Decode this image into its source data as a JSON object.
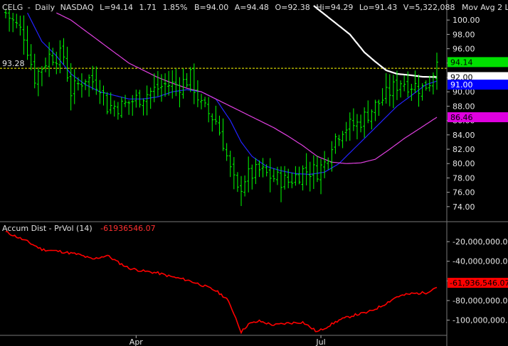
{
  "header": {
    "symbol": "CELG",
    "period": "Daily",
    "exchange": "NASDAQ",
    "last": "L=94.14",
    "change": "1.71",
    "change_pct": "1.85%",
    "bid": "B=94.00",
    "ask": "A=94.48",
    "open": "O=92.38",
    "high": "Hi=94.29",
    "low": "Lo=91.43",
    "volume": "V=5,322,088",
    "study": "Mov Avg 2 Lines ..."
  },
  "reference_line": {
    "label": "93.28",
    "value": 93.28,
    "color": "#ffff00"
  },
  "price_tags": [
    {
      "text": "94.14",
      "value": 94.14,
      "bg": "#00e000",
      "fg": "#000000"
    },
    {
      "text": "92.00",
      "value": 92.05,
      "bg": "#ffffff",
      "fg": "#000000"
    },
    {
      "text": "91.00",
      "value": 91.0,
      "bg": "#0000ff",
      "fg": "#ffffff"
    },
    {
      "text": "86.46",
      "value": 86.46,
      "bg": "#e000e0",
      "fg": "#000000"
    }
  ],
  "lower_panel": {
    "title": "Accum Dist - PrVol (14)",
    "value_label": "-61936546.07",
    "tag_text": "-61,936,546.07",
    "tag_value": -61936546.07,
    "tag_bg": "#ff0000",
    "tag_fg": "#000000"
  },
  "colors": {
    "bars": "#00ff00",
    "ma_short": "#2323ff",
    "ma_mid": "#e040e0",
    "ma_long": "#ffffff",
    "ad_line": "#ff0000",
    "grid": "#444444"
  },
  "chart_data": [
    {
      "type": "ohlc",
      "panel": "price",
      "ylim": [
        72.5,
        102.0
      ],
      "yticks": [
        "100.00",
        "98.00",
        "96.00",
        "94.00",
        "92.00",
        "90.00",
        "88.00",
        "86.00",
        "84.00",
        "82.00",
        "80.00",
        "78.00",
        "76.00",
        "74.00"
      ],
      "ytick_values": [
        100,
        98,
        96,
        94,
        92,
        90,
        88,
        86,
        84,
        82,
        80,
        78,
        76,
        74
      ],
      "xticks": [
        {
          "label": "Apr",
          "index": 36
        },
        {
          "label": "Jul",
          "index": 87
        }
      ],
      "bars": 120,
      "close_anchors": [
        [
          0,
          101
        ],
        [
          5,
          98
        ],
        [
          8,
          92
        ],
        [
          12,
          95
        ],
        [
          16,
          95
        ],
        [
          18,
          90
        ],
        [
          22,
          92
        ],
        [
          26,
          91
        ],
        [
          28,
          88
        ],
        [
          32,
          88
        ],
        [
          36,
          89
        ],
        [
          40,
          90
        ],
        [
          44,
          91
        ],
        [
          48,
          91
        ],
        [
          51,
          92
        ],
        [
          54,
          88
        ],
        [
          58,
          86
        ],
        [
          60,
          83
        ],
        [
          62,
          79
        ],
        [
          64,
          76
        ],
        [
          66,
          78
        ],
        [
          70,
          79
        ],
        [
          74,
          78
        ],
        [
          78,
          77.5
        ],
        [
          82,
          79
        ],
        [
          86,
          79
        ],
        [
          88,
          80
        ],
        [
          90,
          83
        ],
        [
          93,
          85
        ],
        [
          97,
          85.5
        ],
        [
          100,
          87
        ],
        [
          103,
          88.5
        ],
        [
          106,
          90
        ],
        [
          109,
          91.5
        ],
        [
          112,
          91
        ],
        [
          115,
          90.5
        ],
        [
          117,
          91.5
        ],
        [
          119,
          94.14
        ]
      ],
      "series": [
        {
          "name": "MA short",
          "anchors": [
            [
              6,
              101
            ],
            [
              10,
              97
            ],
            [
              14,
              95
            ],
            [
              18,
              92.5
            ],
            [
              22,
              91
            ],
            [
              26,
              90
            ],
            [
              30,
              89.5
            ],
            [
              34,
              89
            ],
            [
              38,
              89
            ],
            [
              42,
              89.3
            ],
            [
              46,
              90
            ],
            [
              50,
              90.3
            ],
            [
              54,
              90
            ],
            [
              58,
              89
            ],
            [
              62,
              86
            ],
            [
              65,
              83
            ],
            [
              68,
              81
            ],
            [
              72,
              79.6
            ],
            [
              76,
              79
            ],
            [
              80,
              78.6
            ],
            [
              84,
              78.5
            ],
            [
              88,
              78.8
            ],
            [
              92,
              80
            ],
            [
              96,
              82
            ],
            [
              100,
              84
            ],
            [
              104,
              86
            ],
            [
              108,
              88
            ],
            [
              112,
              89.5
            ],
            [
              116,
              91
            ],
            [
              119,
              91.5
            ]
          ]
        },
        {
          "name": "MA mid",
          "anchors": [
            [
              14,
              101
            ],
            [
              18,
              100
            ],
            [
              22,
              98.5
            ],
            [
              26,
              97
            ],
            [
              30,
              95.5
            ],
            [
              34,
              94
            ],
            [
              38,
              93
            ],
            [
              42,
              92
            ],
            [
              46,
              91.2
            ],
            [
              50,
              90.5
            ],
            [
              54,
              90
            ],
            [
              58,
              89
            ],
            [
              62,
              88
            ],
            [
              66,
              87
            ],
            [
              70,
              86
            ],
            [
              74,
              85
            ],
            [
              78,
              83.8
            ],
            [
              82,
              82.5
            ],
            [
              86,
              81
            ],
            [
              90,
              80.2
            ],
            [
              94,
              80
            ],
            [
              98,
              80.1
            ],
            [
              102,
              80.6
            ],
            [
              106,
              82
            ],
            [
              110,
              83.5
            ],
            [
              114,
              84.8
            ],
            [
              119,
              86.46
            ]
          ]
        },
        {
          "name": "MA long",
          "anchors": [
            [
              85,
              102
            ],
            [
              90,
              100
            ],
            [
              95,
              98
            ],
            [
              99,
              95.5
            ],
            [
              102,
              94.2
            ],
            [
              105,
              93
            ],
            [
              108,
              92.5
            ],
            [
              112,
              92.3
            ],
            [
              115,
              92.1
            ],
            [
              119,
              92.05
            ]
          ]
        }
      ]
    },
    {
      "type": "line",
      "panel": "accumulation_distribution",
      "ylim": [
        -114000000,
        -4000000
      ],
      "yticks": [
        "-20,000,000.00",
        "-40,000,000.00",
        "-60,000,000.00",
        "-80,000,000.00",
        "-100,000,000.00"
      ],
      "ytick_values": [
        -20000000,
        -40000000,
        -60000000,
        -80000000,
        -100000000
      ],
      "anchors": [
        [
          0,
          -10000000
        ],
        [
          6,
          -20000000
        ],
        [
          10,
          -28000000
        ],
        [
          15,
          -30000000
        ],
        [
          20,
          -33000000
        ],
        [
          24,
          -38000000
        ],
        [
          28,
          -34000000
        ],
        [
          31,
          -41000000
        ],
        [
          34,
          -47000000
        ],
        [
          38,
          -50000000
        ],
        [
          42,
          -52000000
        ],
        [
          46,
          -56000000
        ],
        [
          50,
          -59000000
        ],
        [
          54,
          -64000000
        ],
        [
          58,
          -70000000
        ],
        [
          61,
          -78000000
        ],
        [
          63,
          -93000000
        ],
        [
          65,
          -112000000
        ],
        [
          67,
          -104000000
        ],
        [
          70,
          -101000000
        ],
        [
          74,
          -105000000
        ],
        [
          78,
          -103000000
        ],
        [
          82,
          -102000000
        ],
        [
          86,
          -112000000
        ],
        [
          88,
          -108000000
        ],
        [
          92,
          -100000000
        ],
        [
          96,
          -95000000
        ],
        [
          100,
          -92000000
        ],
        [
          104,
          -85000000
        ],
        [
          108,
          -76000000
        ],
        [
          112,
          -73000000
        ],
        [
          116,
          -72000000
        ],
        [
          119,
          -66000000
        ]
      ]
    }
  ]
}
